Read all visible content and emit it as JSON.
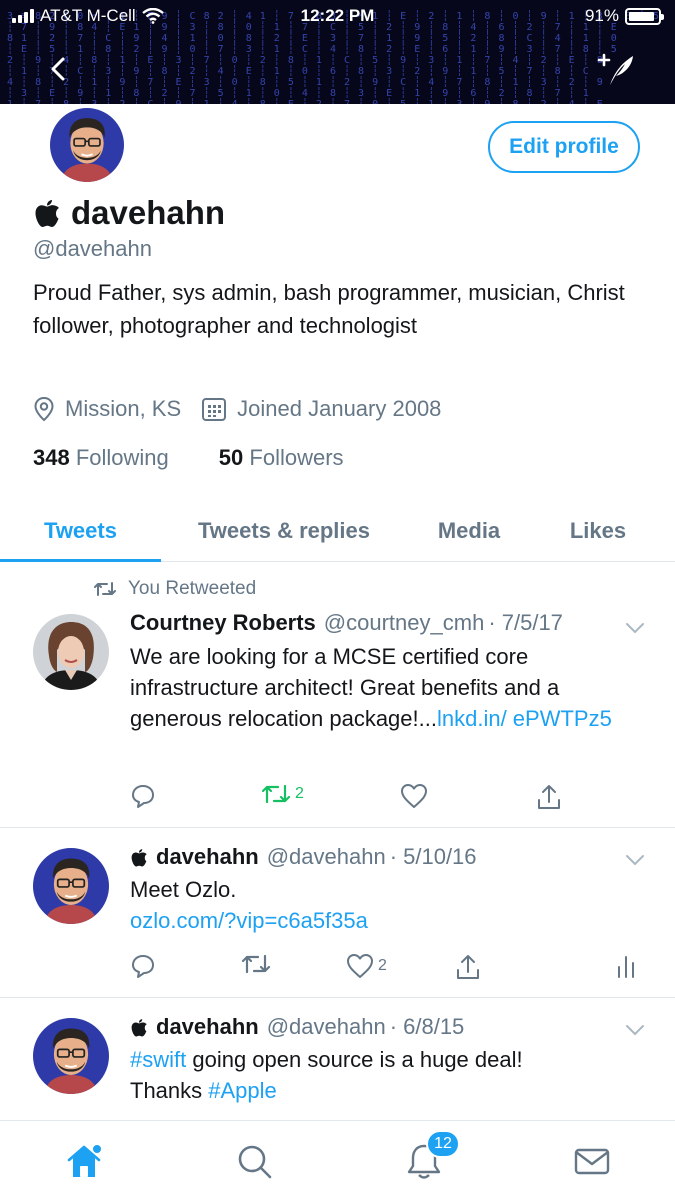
{
  "status_bar": {
    "carrier": "AT&T M-Cell",
    "time": "12:22 PM",
    "battery": "91%",
    "battery_level": 0.91
  },
  "header": {
    "back_icon": "chevron-left-icon",
    "compose_icon": "compose-tweet-icon"
  },
  "profile": {
    "display_name": "davehahn",
    "name_icon": "apple-logo-icon",
    "handle": "@davehahn",
    "edit_button": "Edit profile",
    "bio": "Proud Father, sys admin, bash programmer, musician, Christ follower, photographer and technologist",
    "location": "Mission, KS",
    "joined": "Joined January 2008",
    "following_count": "348",
    "following_label": "Following",
    "followers_count": "50",
    "followers_label": "Followers"
  },
  "tabs": [
    {
      "label": "Tweets",
      "active": true
    },
    {
      "label": "Tweets & replies",
      "active": false
    },
    {
      "label": "Media",
      "active": false
    },
    {
      "label": "Likes",
      "active": false
    }
  ],
  "tweets": [
    {
      "retweeted_label": "You Retweeted",
      "name": "Courtney Roberts",
      "handle": "@courtney_cmh",
      "date": "· 7/5/17",
      "text": "We are looking for a MCSE certified core infrastructure architect! Great benefits and a generous relocation package!...",
      "link": "lnkd.in/ ePWTPz5",
      "retweets": "2",
      "likes": ""
    },
    {
      "name": "davehahn",
      "handle": "@davehahn",
      "date": "· 5/10/16",
      "text": "Meet Ozlo.",
      "link": "ozlo.com/?vip=c6a5f35a",
      "retweets": "",
      "likes": "2"
    },
    {
      "name": "davehahn",
      "handle": "@davehahn",
      "date": "· 6/8/15",
      "hashtag1": "#swift",
      "text_mid": " going open source is a huge deal!",
      "text_thanks": "Thanks ",
      "hashtag2": "#Apple"
    }
  ],
  "bottom_nav": {
    "items": [
      "home-icon",
      "search-icon",
      "notifications-icon",
      "messages-icon"
    ],
    "notification_badge": "12"
  },
  "colors": {
    "accent": "#1da1f2",
    "retweet_green": "#17bf63",
    "muted": "#657786",
    "banner_bg": "#07071c"
  }
}
